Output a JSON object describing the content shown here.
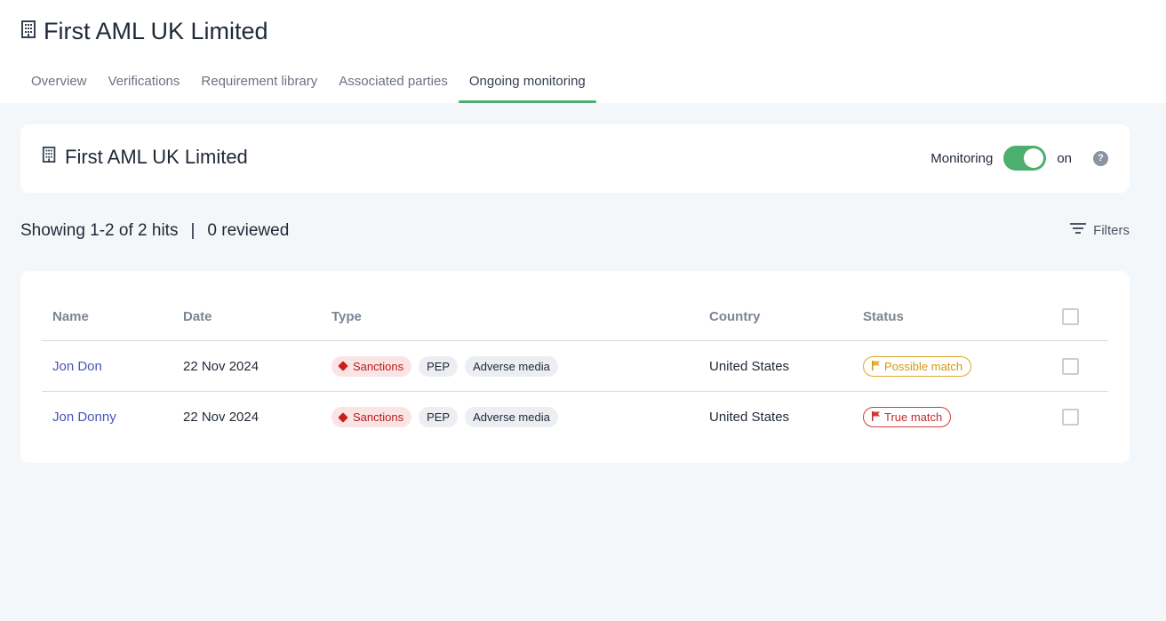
{
  "page": {
    "title": "First AML UK Limited",
    "icon": "building-icon"
  },
  "tabs": [
    {
      "label": "Overview",
      "active": false
    },
    {
      "label": "Verifications",
      "active": false
    },
    {
      "label": "Requirement library",
      "active": false
    },
    {
      "label": "Associated parties",
      "active": false
    },
    {
      "label": "Ongoing monitoring",
      "active": true
    }
  ],
  "entity": {
    "name": "First AML UK Limited",
    "monitoring_label": "Monitoring",
    "monitoring_state": "on",
    "monitoring_on": true
  },
  "summary": {
    "showing": "Showing 1-2 of 2 hits",
    "separator": "|",
    "reviewed": "0 reviewed"
  },
  "filters": {
    "label": "Filters"
  },
  "table": {
    "columns": [
      "Name",
      "Date",
      "Type",
      "Country",
      "Status"
    ],
    "rows": [
      {
        "name": "Jon Don",
        "date": "22 Nov 2024",
        "types": [
          "Sanctions",
          "PEP",
          "Adverse media"
        ],
        "country": "United States",
        "status": "Possible match"
      },
      {
        "name": "Jon Donny",
        "date": "22 Nov 2024",
        "types": [
          "Sanctions",
          "PEP",
          "Adverse media"
        ],
        "country": "United States",
        "status": "True match"
      }
    ]
  },
  "colors": {
    "accent": "#4caf6e",
    "link": "#4854b8",
    "sanctions": "#c81e1e",
    "possible_match": "#d4980f",
    "true_match": "#c52b2b"
  }
}
